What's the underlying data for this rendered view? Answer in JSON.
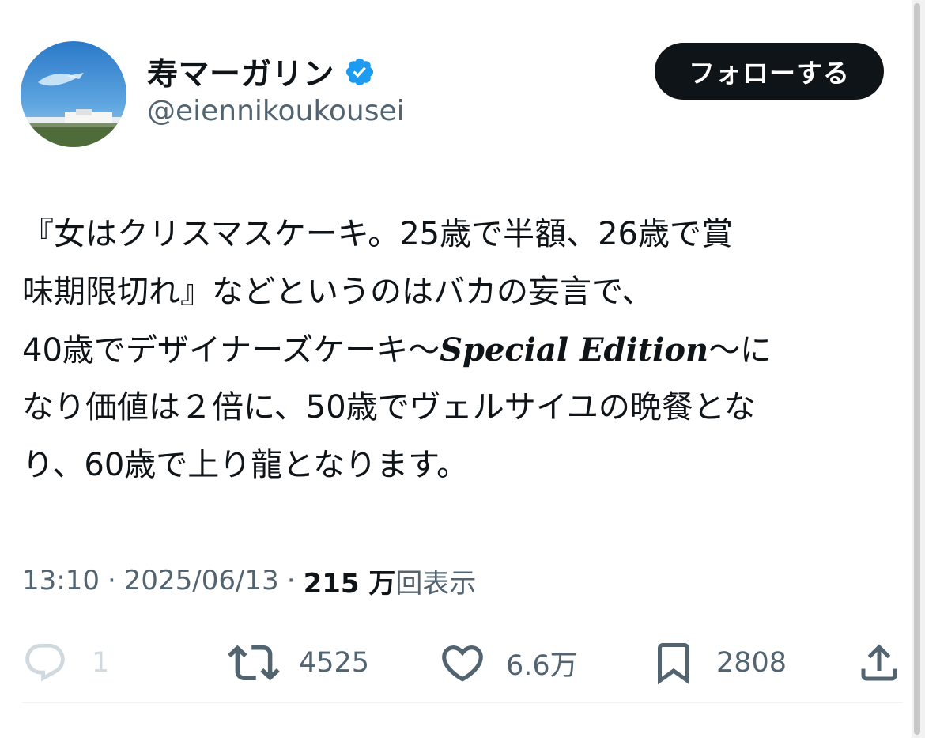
{
  "author": {
    "display_name": "寿マーガリン",
    "handle": "@eiennikoukousei",
    "verified": true,
    "avatar_icon": "avatar-landscape-sky-image"
  },
  "follow_button": {
    "label": "フォローする"
  },
  "tweet": {
    "line1": "『女はクリスマスケーキ。25歳で半額、26歳で賞",
    "line2": "味期限切れ』などというのはバカの妄言で、",
    "line3_a": "40歳でデザイナーズケーキ〜",
    "line3_special": "Special Edition",
    "line3_b": "〜に",
    "line4": "なり価値は２倍に、50歳でヴェルサイユの晩餐とな",
    "line5": "り、60歳で上り龍となります。"
  },
  "meta": {
    "time": "13:10",
    "separator": "·",
    "date": "2025/06/13",
    "views_count": "215 万",
    "views_label": "回表示"
  },
  "actions": {
    "reply": {
      "icon": "reply-icon",
      "count": "1"
    },
    "retweet": {
      "icon": "retweet-icon",
      "count": "4525"
    },
    "like": {
      "icon": "heart-icon",
      "count": "6.6万"
    },
    "bookmark": {
      "icon": "bookmark-icon",
      "count": "2808"
    },
    "share": {
      "icon": "share-icon"
    }
  },
  "colors": {
    "text_primary": "#0f1419",
    "text_secondary": "#536471",
    "verified_blue": "#1d9bf0",
    "follow_button_bg": "#0f1419",
    "follow_button_text": "#ffffff"
  }
}
